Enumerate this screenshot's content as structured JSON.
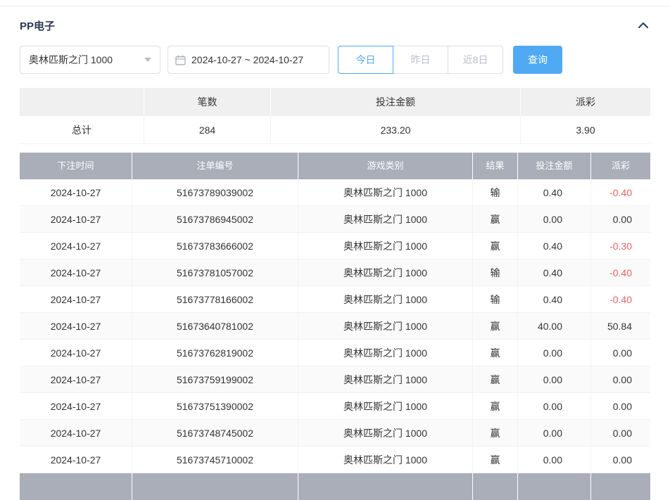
{
  "panel": {
    "title": "PP电子"
  },
  "filters": {
    "game_select": {
      "value": "奥林匹斯之门 1000"
    },
    "date_range": {
      "value": "2024-10-27 ~ 2024-10-27"
    },
    "quick_buttons": [
      {
        "label": "今日",
        "active": true
      },
      {
        "label": "昨日",
        "active": false
      },
      {
        "label": "近8日",
        "active": false
      }
    ],
    "search_label": "查询"
  },
  "summary": {
    "headers": [
      "",
      "笔数",
      "投注金额",
      "派彩"
    ],
    "row": {
      "label": "总计",
      "count": "284",
      "bet_amount": "233.20",
      "payout": "3.90"
    }
  },
  "table": {
    "headers": [
      "下注时间",
      "注单编号",
      "游戏类别",
      "结果",
      "投注金额",
      "派彩"
    ],
    "rows": [
      {
        "date": "2024-10-27",
        "order_id": "51673789039002",
        "game": "奥林匹斯之门 1000",
        "result": "输",
        "bet": "0.40",
        "payout": "-0.40"
      },
      {
        "date": "2024-10-27",
        "order_id": "51673786945002",
        "game": "奥林匹斯之门 1000",
        "result": "赢",
        "bet": "0.00",
        "payout": "0.00"
      },
      {
        "date": "2024-10-27",
        "order_id": "51673783666002",
        "game": "奥林匹斯之门 1000",
        "result": "赢",
        "bet": "0.40",
        "payout": "-0.30"
      },
      {
        "date": "2024-10-27",
        "order_id": "51673781057002",
        "game": "奥林匹斯之门 1000",
        "result": "输",
        "bet": "0.40",
        "payout": "-0.40"
      },
      {
        "date": "2024-10-27",
        "order_id": "51673778166002",
        "game": "奥林匹斯之门 1000",
        "result": "输",
        "bet": "0.40",
        "payout": "-0.40"
      },
      {
        "date": "2024-10-27",
        "order_id": "51673640781002",
        "game": "奥林匹斯之门 1000",
        "result": "赢",
        "bet": "40.00",
        "payout": "50.84"
      },
      {
        "date": "2024-10-27",
        "order_id": "51673762819002",
        "game": "奥林匹斯之门 1000",
        "result": "赢",
        "bet": "0.00",
        "payout": "0.00"
      },
      {
        "date": "2024-10-27",
        "order_id": "51673759199002",
        "game": "奥林匹斯之门 1000",
        "result": "赢",
        "bet": "0.00",
        "payout": "0.00"
      },
      {
        "date": "2024-10-27",
        "order_id": "51673751390002",
        "game": "奥林匹斯之门 1000",
        "result": "赢",
        "bet": "0.00",
        "payout": "0.00"
      },
      {
        "date": "2024-10-27",
        "order_id": "51673748745002",
        "game": "奥林匹斯之门 1000",
        "result": "赢",
        "bet": "0.00",
        "payout": "0.00"
      },
      {
        "date": "2024-10-27",
        "order_id": "51673745710002",
        "game": "奥林匹斯之门 1000",
        "result": "赢",
        "bet": "0.00",
        "payout": "0.00"
      }
    ]
  },
  "colors": {
    "accent": "#4fa9f3",
    "negative": "#f25f5f",
    "table_header_bg": "#a9aeb9"
  }
}
